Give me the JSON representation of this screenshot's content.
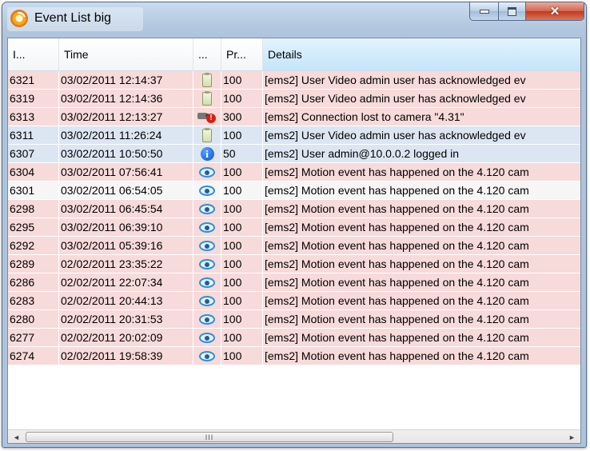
{
  "window": {
    "title": "Event List big"
  },
  "columns": [
    {
      "key": "id",
      "label": "I..."
    },
    {
      "key": "time",
      "label": "Time"
    },
    {
      "key": "type",
      "label": "..."
    },
    {
      "key": "priority",
      "label": "Pr..."
    },
    {
      "key": "details",
      "label": "Details"
    }
  ],
  "colors": {
    "row_pink": "#f7dada",
    "row_blue": "#dce6f2",
    "row_plain": "#f6f6f6",
    "header_active": "#c4e5f9"
  },
  "rows": [
    {
      "id": "6321",
      "time": "03/02/2011 12:14:37",
      "icon": "clipboard-icon",
      "priority": "100",
      "details": "[ems2] User Video admin user has acknowledged ev",
      "tint": "pink"
    },
    {
      "id": "6319",
      "time": "03/02/2011 12:14:36",
      "icon": "clipboard-icon",
      "priority": "100",
      "details": "[ems2] User Video admin user has acknowledged ev",
      "tint": "pink"
    },
    {
      "id": "6313",
      "time": "03/02/2011 12:13:27",
      "icon": "camera-error-icon",
      "priority": "300",
      "details": "[ems2] Connection lost to camera \"4.31\"",
      "tint": "pink"
    },
    {
      "id": "6311",
      "time": "03/02/2011 11:26:24",
      "icon": "clipboard-icon",
      "priority": "100",
      "details": "[ems2] User Video admin user has acknowledged ev",
      "tint": "blue"
    },
    {
      "id": "6307",
      "time": "03/02/2011 10:50:50",
      "icon": "info-icon",
      "priority": "50",
      "details": "[ems2] User admin@10.0.0.2 logged in",
      "tint": "blue"
    },
    {
      "id": "6304",
      "time": "03/02/2011 07:56:41",
      "icon": "eye-icon",
      "priority": "100",
      "details": "[ems2] Motion event has happened on the 4.120 cam",
      "tint": "pink"
    },
    {
      "id": "6301",
      "time": "03/02/2011 06:54:05",
      "icon": "eye-icon",
      "priority": "100",
      "details": "[ems2] Motion event has happened on the 4.120 cam",
      "tint": "plain"
    },
    {
      "id": "6298",
      "time": "03/02/2011 06:45:54",
      "icon": "eye-icon",
      "priority": "100",
      "details": "[ems2] Motion event has happened on the 4.120 cam",
      "tint": "pink"
    },
    {
      "id": "6295",
      "time": "03/02/2011 06:39:10",
      "icon": "eye-icon",
      "priority": "100",
      "details": "[ems2] Motion event has happened on the 4.120 cam",
      "tint": "pink"
    },
    {
      "id": "6292",
      "time": "03/02/2011 05:39:16",
      "icon": "eye-icon",
      "priority": "100",
      "details": "[ems2] Motion event has happened on the 4.120 cam",
      "tint": "pink"
    },
    {
      "id": "6289",
      "time": "02/02/2011 23:35:22",
      "icon": "eye-icon",
      "priority": "100",
      "details": "[ems2] Motion event has happened on the 4.120 cam",
      "tint": "pink"
    },
    {
      "id": "6286",
      "time": "02/02/2011 22:07:34",
      "icon": "eye-icon",
      "priority": "100",
      "details": "[ems2] Motion event has happened on the 4.120 cam",
      "tint": "pink"
    },
    {
      "id": "6283",
      "time": "02/02/2011 20:44:13",
      "icon": "eye-icon",
      "priority": "100",
      "details": "[ems2] Motion event has happened on the 4.120 cam",
      "tint": "pink"
    },
    {
      "id": "6280",
      "time": "02/02/2011 20:31:53",
      "icon": "eye-icon",
      "priority": "100",
      "details": "[ems2] Motion event has happened on the 4.120 cam",
      "tint": "pink"
    },
    {
      "id": "6277",
      "time": "02/02/2011 20:02:09",
      "icon": "eye-icon",
      "priority": "100",
      "details": "[ems2] Motion event has happened on the 4.120 cam",
      "tint": "pink"
    },
    {
      "id": "6274",
      "time": "02/02/2011 19:58:39",
      "icon": "eye-icon",
      "priority": "100",
      "details": "[ems2] Motion event has happened on the 4.120 cam",
      "tint": "pink"
    }
  ],
  "scrollbar": {
    "left_arrow": "◄",
    "thumb_grip": "III",
    "right_arrow": "►"
  }
}
